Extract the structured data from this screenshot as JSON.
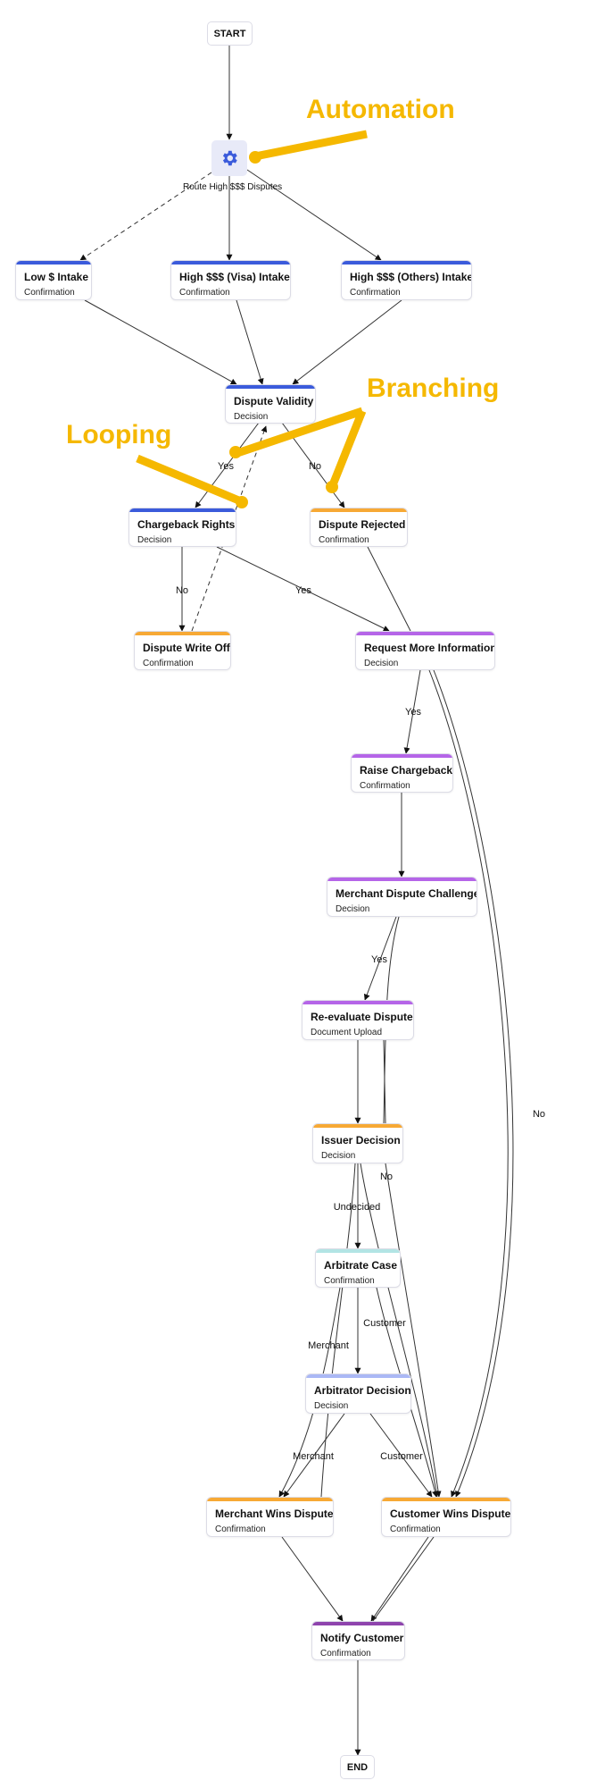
{
  "colors": {
    "intake": "#3b5bdb",
    "decision_blue": "#3b5bdb",
    "orange": "#f7a935",
    "purple": "#b565e8",
    "teal": "#b2e4e4",
    "periwinkle": "#aab8f5",
    "dark_purple": "#8e44ad",
    "annotation": "#f5b800",
    "gear": "#3b5bdb"
  },
  "terminals": {
    "start": "START",
    "end": "END"
  },
  "automation": {
    "label": "Route High $$$ Disputes",
    "icon": "gear-icon"
  },
  "nodes": {
    "low_intake": {
      "title": "Low $ Intake",
      "sub": "Confirmation"
    },
    "visa_intake": {
      "title": "High $$$ (Visa) Intake",
      "sub": "Confirmation"
    },
    "others_intake": {
      "title": "High $$$ (Others) Intake",
      "sub": "Confirmation"
    },
    "dispute_validity": {
      "title": "Dispute Validity",
      "sub": "Decision"
    },
    "chargeback_rights": {
      "title": "Chargeback Rights",
      "sub": "Decision"
    },
    "dispute_rejected": {
      "title": "Dispute Rejected",
      "sub": "Confirmation"
    },
    "dispute_write_off": {
      "title": "Dispute Write Off",
      "sub": "Confirmation"
    },
    "request_more_info": {
      "title": "Request More Information",
      "sub": "Decision"
    },
    "raise_chargeback": {
      "title": "Raise Chargeback",
      "sub": "Confirmation"
    },
    "merchant_challenge": {
      "title": "Merchant Dispute Challenge",
      "sub": "Decision"
    },
    "reevaluate": {
      "title": "Re-evaluate Dispute",
      "sub": "Document Upload"
    },
    "issuer_decision": {
      "title": "Issuer Decision",
      "sub": "Decision"
    },
    "arbitrate_case": {
      "title": "Arbitrate Case",
      "sub": "Confirmation"
    },
    "arbitrator_decision": {
      "title": "Arbitrator Decision",
      "sub": "Decision"
    },
    "merchant_wins": {
      "title": "Merchant Wins Dispute",
      "sub": "Confirmation"
    },
    "customer_wins": {
      "title": "Customer Wins Dispute",
      "sub": "Confirmation"
    },
    "notify_customer": {
      "title": "Notify Customer",
      "sub": "Confirmation"
    }
  },
  "edge_labels": {
    "validity_yes": "Yes",
    "validity_no": "No",
    "rights_no": "No",
    "rights_yes": "Yes",
    "rmi_yes": "Yes",
    "rmi_no": "No",
    "challenge_yes": "Yes",
    "issuer_no": "No",
    "issuer_undecided": "Undecided",
    "arb_case_merchant": "Merchant",
    "arb_case_customer": "Customer",
    "arbitrator_merchant": "Merchant",
    "arbitrator_customer": "Customer"
  },
  "annotations": {
    "automation": "Automation",
    "branching": "Branching",
    "looping": "Looping"
  }
}
